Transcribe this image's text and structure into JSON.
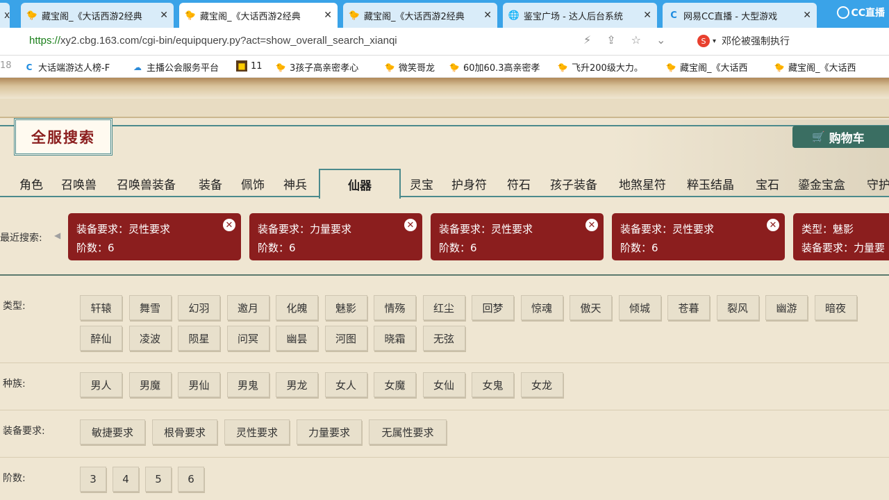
{
  "browser": {
    "tabs": [
      {
        "title": "x",
        "icon": "chevron-icon",
        "active": false
      },
      {
        "title": "藏宝阁_《大话西游2经典",
        "icon": "chick-icon",
        "active": false
      },
      {
        "title": "藏宝阁_《大话西游2经典",
        "icon": "chick-icon",
        "active": true
      },
      {
        "title": "藏宝阁_《大话西游2经典",
        "icon": "chick-icon",
        "active": false
      },
      {
        "title": "鉴宝广场 - 达人后台系统",
        "icon": "globe-icon",
        "active": false
      },
      {
        "title": "网易CC直播 - 大型游戏",
        "icon": "cc-icon",
        "active": false
      }
    ],
    "cc_logo_text": "CC直播",
    "url_prefix": "https://",
    "url_rest": "xy2.cbg.163.com/cgi-bin/equipquery.py?act=show_overall_search_xianqi",
    "search_engine_text": "邓伦被强制执行",
    "bookmarks": [
      {
        "label": "18",
        "icon": ""
      },
      {
        "label": "大话端游达人榜-F",
        "icon": "cc-icon"
      },
      {
        "label": "主播公会服务平台",
        "icon": "cloud-icon"
      },
      {
        "label": "11",
        "icon": "game-icon"
      },
      {
        "label": "3孩子高亲密孝心",
        "icon": "chick-icon"
      },
      {
        "label": "微笑哥龙",
        "icon": "chick-icon"
      },
      {
        "label": "60加60.3高亲密孝",
        "icon": "chick-icon"
      },
      {
        "label": "飞升200级大力。",
        "icon": "chick-icon"
      },
      {
        "label": "藏宝阁_《大话西",
        "icon": "chick-icon"
      },
      {
        "label": "藏宝阁_《大话西",
        "icon": "chick-icon"
      }
    ]
  },
  "header": {
    "title": "全服搜索",
    "cart_label": "购物车"
  },
  "categories": [
    "角色",
    "召唤兽",
    "召唤兽装备",
    "装备",
    "佩饰",
    "神兵",
    "仙器",
    "灵宝",
    "护身符",
    "符石",
    "孩子装备",
    "地煞星符",
    "粹玉结晶",
    "宝石",
    "鎏金宝盒",
    "守护"
  ],
  "active_category": "仙器",
  "recent": {
    "label": "最近搜索:",
    "cards": [
      {
        "line1": "装备要求：灵性要求",
        "line2": "阶数：6"
      },
      {
        "line1": "装备要求：力量要求",
        "line2": "阶数：6"
      },
      {
        "line1": "装备要求：灵性要求",
        "line2": "阶数：6"
      },
      {
        "line1": "装备要求：灵性要求",
        "line2": "阶数：6"
      },
      {
        "line1": "类型：魅影",
        "line2": "装备要求：力量要"
      }
    ]
  },
  "filters": {
    "type": {
      "label": "类型:",
      "row1": [
        "轩辕",
        "舞雪",
        "幻羽",
        "邀月",
        "化魄",
        "魅影",
        "情殇",
        "红尘",
        "回梦",
        "惊魂",
        "傲天",
        "倾城",
        "苍暮",
        "裂风",
        "幽游",
        "暗夜"
      ],
      "row2": [
        "醉仙",
        "凌波",
        "陨星",
        "问冥",
        "幽昙",
        "河图",
        "晓霜",
        "无弦"
      ]
    },
    "race": {
      "label": "种族:",
      "options": [
        "男人",
        "男魔",
        "男仙",
        "男鬼",
        "男龙",
        "女人",
        "女魔",
        "女仙",
        "女鬼",
        "女龙"
      ]
    },
    "requirement": {
      "label": "装备要求:",
      "options": [
        "敏捷要求",
        "根骨要求",
        "灵性要求",
        "力量要求",
        "无属性要求"
      ]
    },
    "tier": {
      "label": "阶数:",
      "options": [
        "3",
        "4",
        "5",
        "6"
      ]
    }
  }
}
